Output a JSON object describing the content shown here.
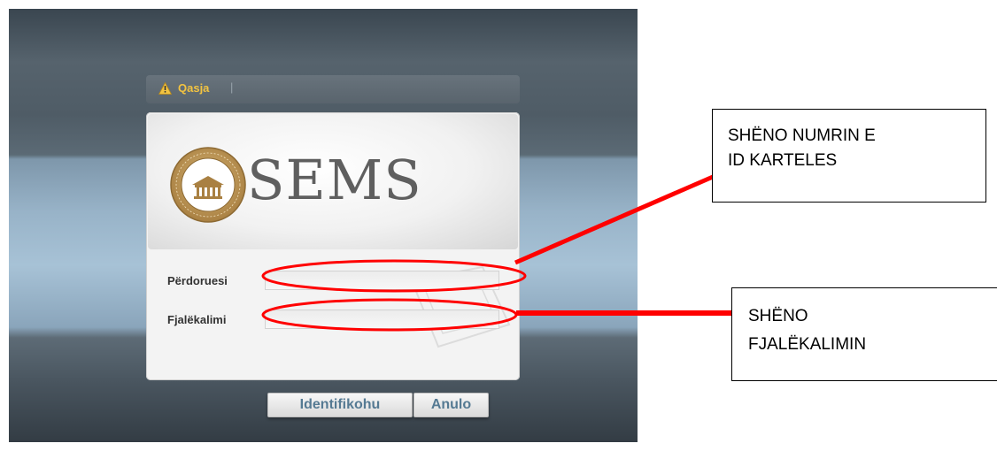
{
  "header_bar": {
    "label": "Qasja",
    "separator": "|"
  },
  "logo": {
    "text": "SEMS",
    "seal_icon": "university-seal-icon"
  },
  "form": {
    "username_label": "Përdoruesi",
    "username_value": "",
    "password_label": "Fjalëkalimi",
    "password_value": ""
  },
  "buttons": {
    "login": "Identifikohu",
    "cancel": "Anulo"
  },
  "annotations": {
    "id_callout": [
      "SHËNO NUMRIN E",
      "ID KARTELES"
    ],
    "password_callout": [
      "SHËNO",
      "FJALËKALIMIN"
    ]
  },
  "colors": {
    "accent_text": "#557a93",
    "warning": "#f2c341",
    "annotation": "#ff0000"
  }
}
